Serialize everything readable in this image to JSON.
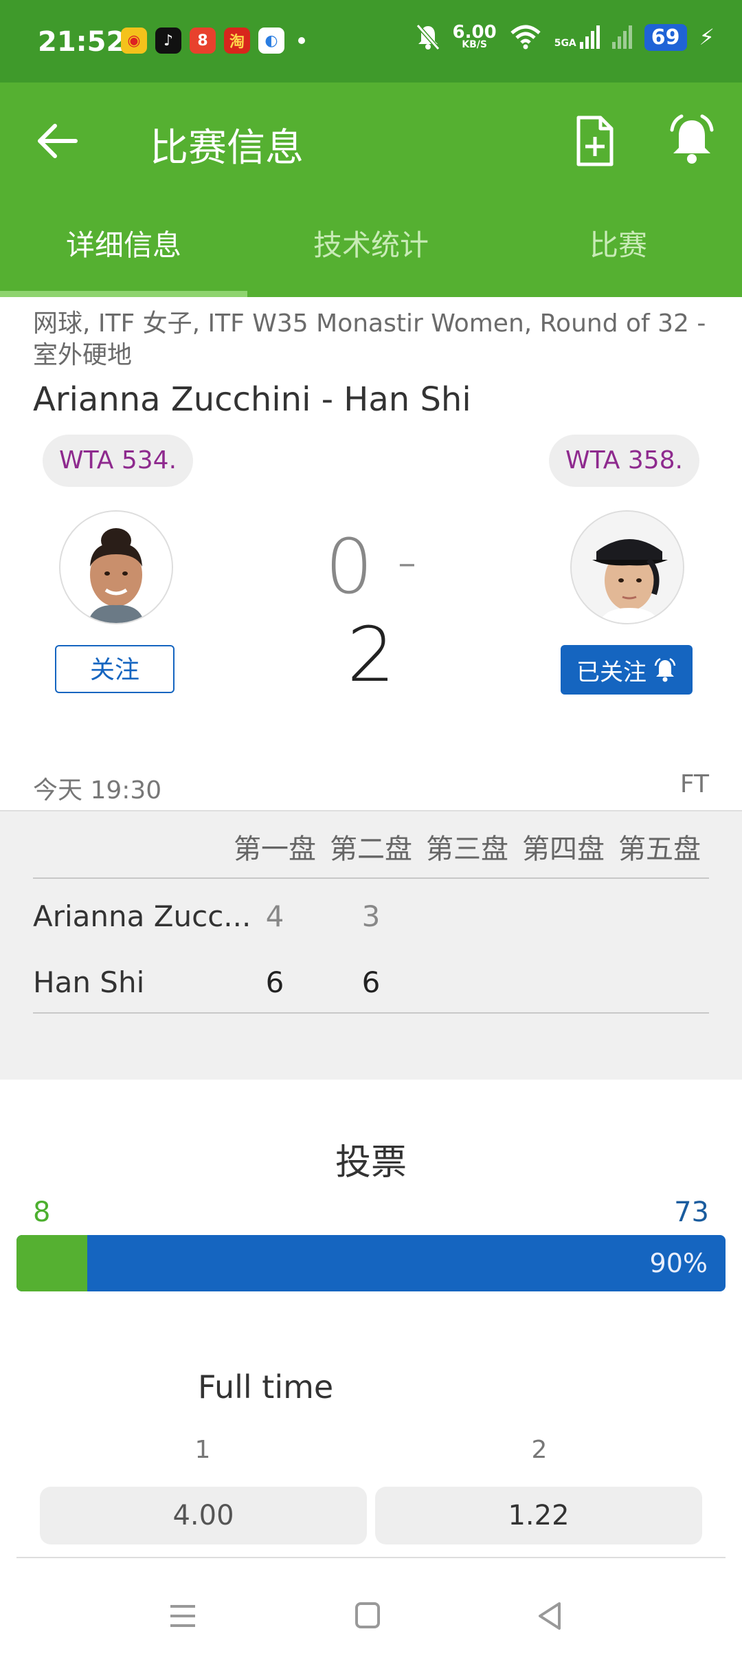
{
  "status_bar": {
    "time": "21:52",
    "speed_value": "6.00",
    "speed_unit": "KB/S",
    "network": "5GA",
    "battery": "69"
  },
  "app_bar": {
    "title": "比赛信息"
  },
  "tabs": [
    {
      "label": "详细信息",
      "active": true
    },
    {
      "label": "技术统计",
      "active": false
    },
    {
      "label": "比赛",
      "active": false
    }
  ],
  "match": {
    "tournament": "网球, ITF 女子, ITF W35 Monastir Women, Round of 32 - 室外硬地",
    "title": "Arianna Zucchini - Han Shi",
    "home_rank": "WTA 534.",
    "away_rank": "WTA 358.",
    "home_score": "0",
    "score_separator": "-",
    "away_score": "2",
    "home_follow_label": "关注",
    "away_follow_label": "已关注",
    "time": "今天 19:30",
    "status": "FT"
  },
  "score_table": {
    "headers": [
      "第一盘",
      "第二盘",
      "第三盘",
      "第四盘",
      "第五盘"
    ],
    "rows": [
      {
        "player": "Arianna Zucc...",
        "sets": [
          "4",
          "3"
        ]
      },
      {
        "player": "Han Shi",
        "sets": [
          "6",
          "6"
        ]
      }
    ]
  },
  "vote": {
    "title": "投票",
    "home_votes": "8",
    "away_votes": "73",
    "away_percent_label": "90%",
    "home_share": 0.1,
    "colors": {
      "home": "#55b031",
      "away": "#1565c0"
    }
  },
  "odds": {
    "title": "Full time",
    "home_label": "1",
    "away_label": "2",
    "home_value": "4.00",
    "away_value": "1.22"
  },
  "colors": {
    "status_bar": "#3f9a2b",
    "app_bar": "#55b031",
    "accent_blue": "#1565c0",
    "rank_text": "#8e2a8e"
  }
}
